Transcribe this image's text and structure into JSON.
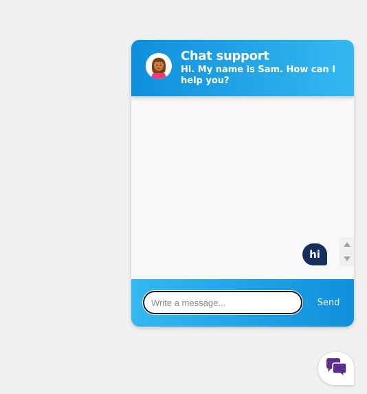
{
  "header": {
    "title": "Chat support",
    "subtitle": "Hi. My name is Sam. How can I help you?",
    "avatar_icon": "female-agent-avatar"
  },
  "messages": [
    {
      "sender": "user",
      "text": "hi"
    }
  ],
  "composer": {
    "placeholder": "Write a message...",
    "value": "",
    "send_label": "Send"
  },
  "launcher": {
    "icon": "chat-bubbles-icon"
  },
  "colors": {
    "header_gradient_start": "#0f8fdc",
    "header_gradient_end": "#35b8f1",
    "user_bubble": "#142f5b",
    "launcher_icon": "#5b2d8e",
    "background": "#f0f0f0"
  }
}
